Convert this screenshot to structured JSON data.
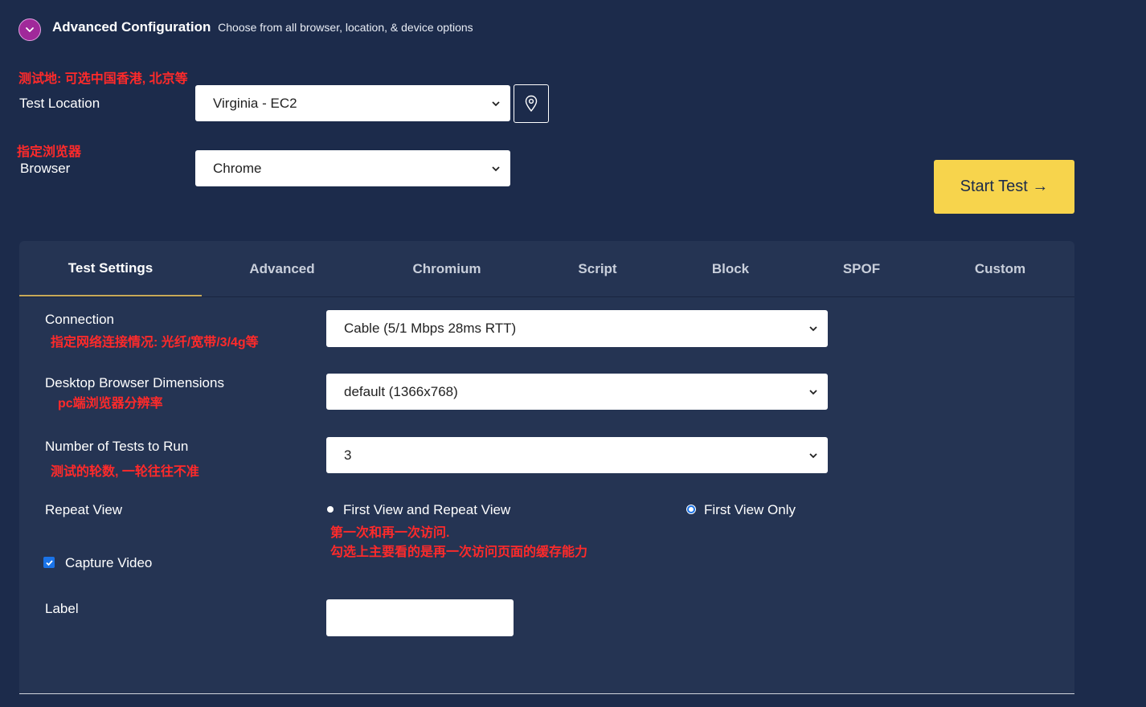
{
  "header": {
    "title": "Advanced Configuration",
    "subtitle": "Choose from all browser, location, & device options"
  },
  "location": {
    "annotation": "测试地: 可选中国香港, 北京等",
    "label": "Test Location",
    "value": "Virginia - EC2"
  },
  "browser": {
    "annotation": "指定浏览器",
    "label": "Browser",
    "value": "Chrome"
  },
  "start_button": "Start Test →",
  "tabs": [
    {
      "label": "Test Settings",
      "active": true
    },
    {
      "label": "Advanced"
    },
    {
      "label": "Chromium"
    },
    {
      "label": "Script"
    },
    {
      "label": "Block"
    },
    {
      "label": "SPOF"
    },
    {
      "label": "Custom"
    }
  ],
  "settings": {
    "connection": {
      "label": "Connection",
      "annotation": "指定网络连接情况: 光纤/宽带/3/4g等",
      "value": "Cable (5/1 Mbps 28ms RTT)"
    },
    "dimensions": {
      "label": "Desktop Browser Dimensions",
      "annotation": "pc端浏览器分辨率",
      "value": "default (1366x768)"
    },
    "num_tests": {
      "label": "Number of Tests to Run",
      "annotation": "测试的轮数, 一轮往往不准",
      "value": "3"
    },
    "repeat_view": {
      "label": "Repeat View",
      "option1": "First View and Repeat View",
      "option2": "First View Only",
      "selected": "First View Only",
      "annotation_line1": "第一次和再一次访问.",
      "annotation_line2": "勾选上主要看的是再一次访问页面的缓存能力"
    },
    "capture_video": {
      "label": "Capture Video",
      "checked": true
    },
    "label_field": {
      "label": "Label",
      "value": ""
    }
  },
  "colors": {
    "background": "#1c2b4b",
    "panel": "#253453",
    "accent_button": "#f7d44c",
    "toggle": "#a0299a",
    "annotation": "#ff2a2a",
    "tab_underline": "#c8a958"
  }
}
